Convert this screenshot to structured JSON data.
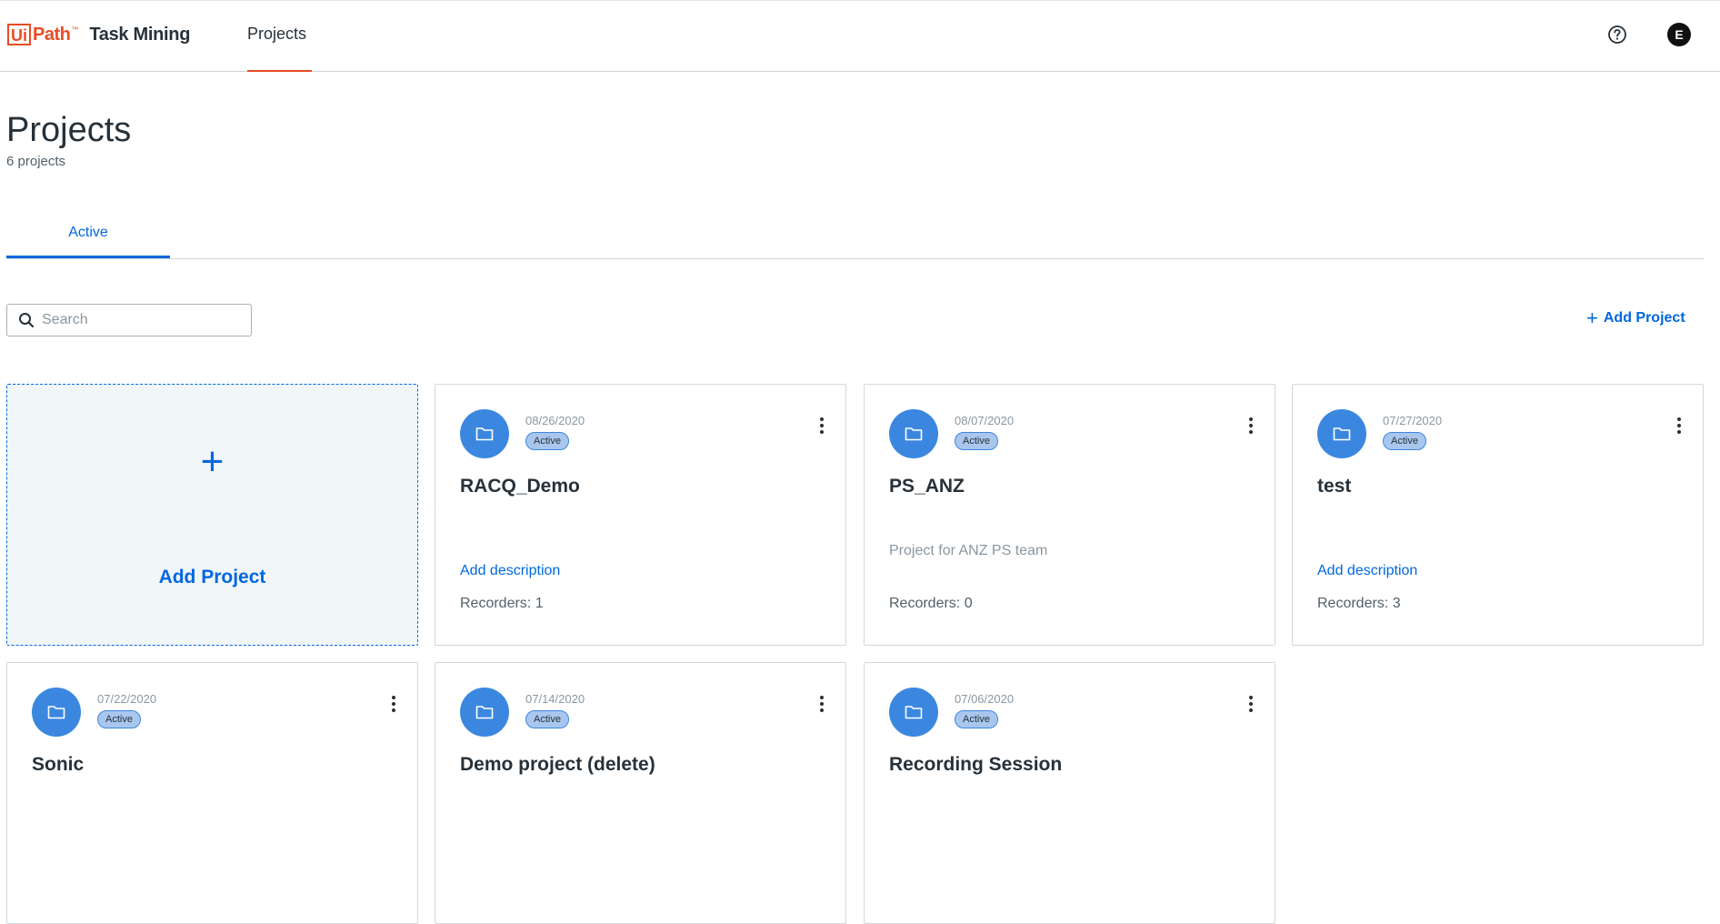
{
  "header": {
    "logo_ui": "Ui",
    "logo_path": "Path",
    "logo_tm": "™",
    "product": "Task Mining",
    "nav_projects": "Projects",
    "avatar_initial": "E",
    "accent_color": "#e84c25"
  },
  "page": {
    "title": "Projects",
    "count": "6 projects",
    "tab_active": "Active"
  },
  "toolbar": {
    "search_placeholder": "Search",
    "add_project_label": "Add Project"
  },
  "add_card": {
    "label": "Add Project"
  },
  "projects": [
    {
      "date": "08/26/2020",
      "status": "Active",
      "name": "RACQ_Demo",
      "description_link": "Add description",
      "description": "",
      "recorders": "Recorders: 1"
    },
    {
      "date": "08/07/2020",
      "status": "Active",
      "name": "PS_ANZ",
      "description_link": "",
      "description": "Project for ANZ PS team",
      "recorders": "Recorders: 0"
    },
    {
      "date": "07/27/2020",
      "status": "Active",
      "name": "test",
      "description_link": "Add description",
      "description": "",
      "recorders": "Recorders: 3"
    },
    {
      "date": "07/22/2020",
      "status": "Active",
      "name": "Sonic",
      "description_link": "",
      "description": "",
      "recorders": ""
    },
    {
      "date": "07/14/2020",
      "status": "Active",
      "name": "Demo project (delete)",
      "description_link": "",
      "description": "",
      "recorders": ""
    },
    {
      "date": "07/06/2020",
      "status": "Active",
      "name": "Recording Session",
      "description_link": "",
      "description": "",
      "recorders": ""
    }
  ]
}
